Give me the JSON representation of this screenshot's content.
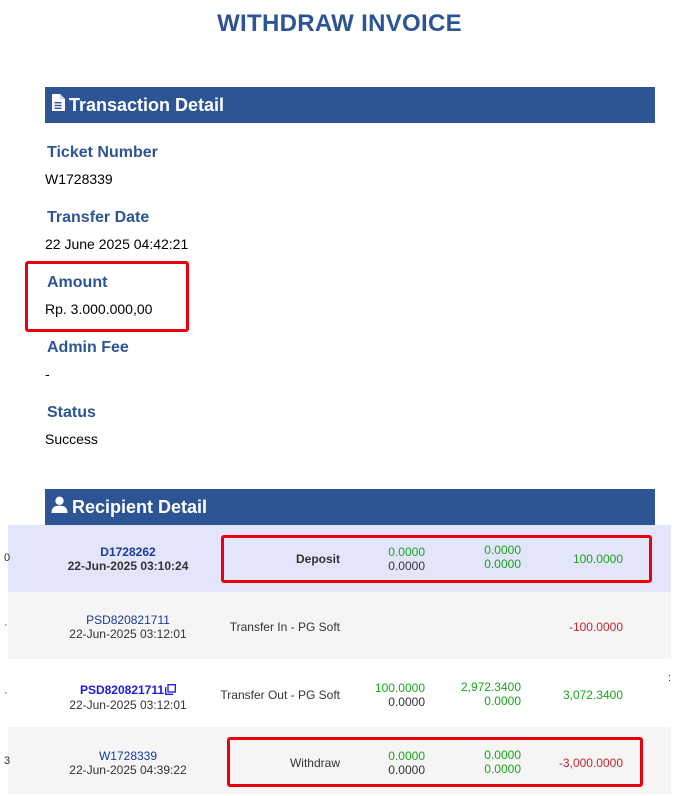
{
  "page_title": "WITHDRAW INVOICE",
  "transaction_section": {
    "title": "Transaction Detail",
    "icon": "document-icon",
    "fields": {
      "ticket_number": {
        "label": "Ticket Number",
        "value": "W1728339"
      },
      "transfer_date": {
        "label": "Transfer Date",
        "value": "22 June 2025 04:42:21"
      },
      "amount": {
        "label": "Amount",
        "value": "Rp. 3.000.000,00"
      },
      "admin_fee": {
        "label": "Admin Fee",
        "value": "-"
      },
      "status": {
        "label": "Status",
        "value": "Success"
      }
    }
  },
  "recipient_section": {
    "title": "Recipient Detail",
    "icon": "user-icon"
  },
  "colors": {
    "brand_blue": "#2d5596",
    "highlight_red": "#e8000b",
    "positive_green": "#1aa31a",
    "negative_red": "#c0282d"
  },
  "transactions": [
    {
      "edge_left": "0",
      "edge_right": "",
      "id": "D1728262",
      "date": "22-Jun-2025 03:10:24",
      "type": "Deposit",
      "col1_top": "0.0000",
      "col1_bottom": "0.0000",
      "col2_top": "0.0000",
      "col2_bottom": "0.0000",
      "result": "100.0000"
    },
    {
      "edge_left": "·",
      "edge_right": "",
      "id": "PSD820821711",
      "date": "22-Jun-2025 03:12:01",
      "type": "Transfer In - PG Soft",
      "col1_top": "",
      "col1_bottom": "",
      "col2_top": "",
      "col2_bottom": "",
      "result": "-100.0000"
    },
    {
      "edge_left": "·",
      "edge_right": ":",
      "id": "PSD820821711",
      "date": "22-Jun-2025 03:12:01",
      "type": "Transfer Out - PG Soft",
      "col1_top": "100.0000",
      "col1_bottom": "0.0000",
      "col2_top": "2,972.3400",
      "col2_bottom": "0.0000",
      "result": "3,072.3400"
    },
    {
      "edge_left": "3",
      "edge_right": "",
      "id": "W1728339",
      "date": "22-Jun-2025 04:39:22",
      "type": "Withdraw",
      "col1_top": "0.0000",
      "col1_bottom": "0.0000",
      "col2_top": "0.0000",
      "col2_bottom": "0.0000",
      "result": "-3,000.0000"
    }
  ]
}
